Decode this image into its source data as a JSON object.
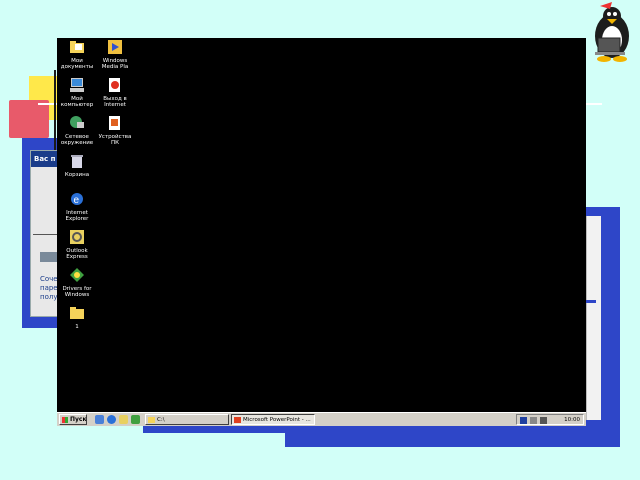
{
  "background_color": "#d2fff8",
  "accent_blue": "#2e46c8",
  "left_window": {
    "title": "Вас п",
    "text_lines": [
      "Сочет",
      "паре",
      "полу"
    ]
  },
  "desktop": {
    "icons": [
      {
        "name": "my-documents",
        "icon": "folder-documents-icon",
        "label": "Мои\nдокументы"
      },
      {
        "name": "media-player",
        "icon": "media-player-icon",
        "label": "Windows\nMedia Pla"
      },
      {
        "name": "my-computer",
        "icon": "computer-icon",
        "label": "Мой\nкомпьютер"
      },
      {
        "name": "internet-access",
        "icon": "internet-access-icon",
        "label": "Выход в\nInternet"
      },
      {
        "name": "network",
        "icon": "network-neighborhood-icon",
        "label": "Сетевое\nокружение"
      },
      {
        "name": "pc-device",
        "icon": "pc-device-icon",
        "label": "Устройства\nПК"
      },
      {
        "name": "recycle-bin",
        "icon": "recycle-bin-icon",
        "label": "Корзина"
      },
      {
        "name": "internet-explorer",
        "icon": "internet-explorer-icon",
        "label": "Internet\nExplorer"
      },
      {
        "name": "outlook",
        "icon": "outlook-express-icon",
        "label": "Outlook\nExpress"
      },
      {
        "name": "desktop-cleanup",
        "icon": "cleanup-icon",
        "label": "Drivers for\nWindows"
      },
      {
        "name": "folder",
        "icon": "folder-icon",
        "label": "1"
      }
    ]
  },
  "taskbar": {
    "start_label": "Пуск",
    "tasks": [
      {
        "label": "C:\\",
        "active": false
      },
      {
        "label": "Microsoft PowerPoint - ...",
        "active": true
      }
    ],
    "clock": "10:00"
  }
}
